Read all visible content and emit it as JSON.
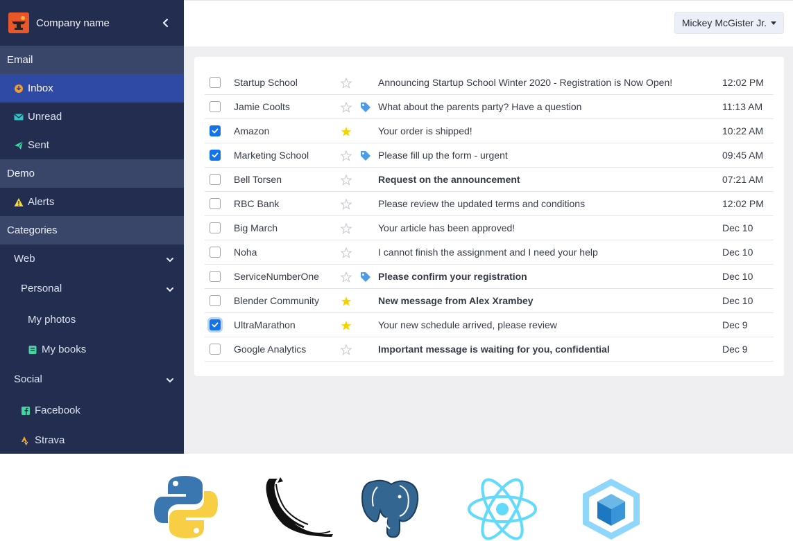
{
  "brand": {
    "name": "Company name"
  },
  "user": {
    "name": "Mickey McGister Jr."
  },
  "sidebar": {
    "email_header": "Email",
    "email_items": [
      {
        "label": "Inbox",
        "icon": "inbox-icon",
        "active": true
      },
      {
        "label": "Unread",
        "icon": "envelope-icon",
        "active": false
      },
      {
        "label": "Sent",
        "icon": "paper-plane-icon",
        "active": false
      }
    ],
    "demo_header": "Demo",
    "demo_items": [
      {
        "label": "Alerts",
        "icon": "warning-icon"
      }
    ],
    "categories_header": "Categories",
    "web": "Web",
    "personal": "Personal",
    "my_photos": "My photos",
    "my_books": "My books",
    "social": "Social",
    "facebook": "Facebook",
    "strava": "Strava"
  },
  "mails": [
    {
      "sender": "Startup School",
      "starred": false,
      "tagged": false,
      "subject": "Announcing Startup School Winter 2020 - Registration is Now Open!",
      "bold": false,
      "time": "12:02 PM",
      "checked": false
    },
    {
      "sender": "Jamie Coolts",
      "starred": false,
      "tagged": true,
      "subject": "What about the parents party? Have a question",
      "bold": false,
      "time": "11:13 AM",
      "checked": false
    },
    {
      "sender": "Amazon",
      "starred": true,
      "tagged": false,
      "subject": "Your order is shipped!",
      "bold": false,
      "time": "10:22 AM",
      "checked": true
    },
    {
      "sender": "Marketing School",
      "starred": false,
      "tagged": true,
      "subject": "Please fill up the form - urgent",
      "bold": false,
      "time": "09:45 AM",
      "checked": true
    },
    {
      "sender": "Bell Torsen",
      "starred": false,
      "tagged": false,
      "subject": "Request on the announcement",
      "bold": true,
      "time": "07:21 AM",
      "checked": false
    },
    {
      "sender": "RBC Bank",
      "starred": false,
      "tagged": false,
      "subject": "Please review the updated terms and conditions",
      "bold": false,
      "time": "12:02 PM",
      "checked": false
    },
    {
      "sender": "Big March",
      "starred": false,
      "tagged": false,
      "subject": "Your article has been approved!",
      "bold": false,
      "time": "Dec 10",
      "checked": false
    },
    {
      "sender": "Noha",
      "starred": false,
      "tagged": false,
      "subject": "I cannot finish the assignment and I need your help",
      "bold": false,
      "time": "Dec 10",
      "checked": false
    },
    {
      "sender": "ServiceNumberOne",
      "starred": false,
      "tagged": true,
      "subject": "Please confirm your registration",
      "bold": true,
      "time": "Dec 10",
      "checked": false
    },
    {
      "sender": "Blender Community",
      "starred": true,
      "tagged": false,
      "subject": "New message from Alex Xrambey",
      "bold": true,
      "time": "Dec 10",
      "checked": false
    },
    {
      "sender": "UltraMarathon",
      "starred": true,
      "tagged": false,
      "subject": "Your new schedule arrived, please review",
      "bold": false,
      "time": "Dec 9",
      "checked": true
    },
    {
      "sender": "Google Analytics",
      "starred": false,
      "tagged": false,
      "subject": "Important message is waiting for you, confidential",
      "bold": true,
      "time": "Dec 9",
      "checked": false
    }
  ],
  "logos": [
    "python-logo",
    "flask-logo",
    "postgresql-logo",
    "react-logo",
    "webpack-logo"
  ],
  "colors": {
    "sidebar_bg": "#222d4f",
    "section_bg": "#394669",
    "active_bg": "#2f4aa5",
    "star_on": "#f2d500",
    "tag": "#4c9be8",
    "checkbox_on": "#1473e6"
  }
}
